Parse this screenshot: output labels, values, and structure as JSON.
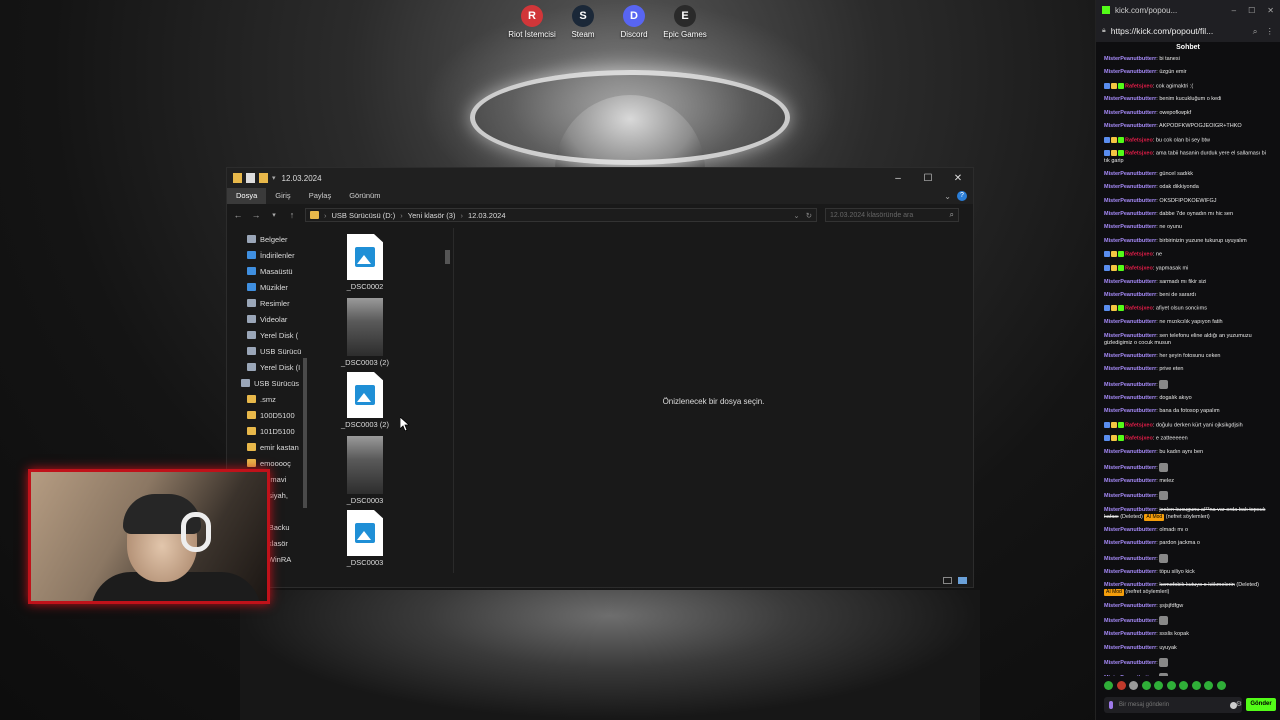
{
  "desktop": {
    "icons": [
      {
        "label": "Riot İstemcisi",
        "icon": "riot-icon",
        "color": "#d13639"
      },
      {
        "label": "Steam",
        "icon": "steam-icon",
        "color": "#1b2838"
      },
      {
        "label": "Discord",
        "icon": "discord-icon",
        "color": "#5865f2"
      },
      {
        "label": "Epic Games",
        "icon": "epic-games-icon",
        "color": "#2a2a2a"
      }
    ]
  },
  "explorer": {
    "title": "12.03.2024",
    "ribbon_tabs": [
      "Dosya",
      "Giriş",
      "Paylaş",
      "Görünüm"
    ],
    "breadcrumb": [
      "USB Sürücüsü (D:)",
      "Yeni klasör (3)",
      "12.03.2024"
    ],
    "search_placeholder": "12.03.2024 klasöründe ara",
    "nav_items": [
      {
        "label": "Belgeler",
        "icon": "documents-icon"
      },
      {
        "label": "İndirilenler",
        "icon": "downloads-icon"
      },
      {
        "label": "Masaüstü",
        "icon": "desktop-icon"
      },
      {
        "label": "Müzikler",
        "icon": "music-icon"
      },
      {
        "label": "Resimler",
        "icon": "pictures-icon"
      },
      {
        "label": "Videolar",
        "icon": "videos-icon"
      },
      {
        "label": "Yerel Disk (",
        "icon": "drive-icon"
      },
      {
        "label": "USB Sürücü",
        "icon": "usb-drive-icon"
      },
      {
        "label": "Yerel Disk (I",
        "icon": "drive-icon"
      },
      {
        "label": "USB Sürücüs",
        "icon": "usb-drive-icon"
      },
      {
        "label": ".smz",
        "icon": "folder-icon"
      },
      {
        "label": "100D5100",
        "icon": "folder-icon"
      },
      {
        "label": "101D5100",
        "icon": "folder-icon"
      },
      {
        "label": "emir kastan",
        "icon": "folder-icon"
      },
      {
        "label": "emooooç",
        "icon": "folder-icon"
      },
      {
        "label": "up mavi",
        "icon": "folder-icon"
      },
      {
        "label": "upsiyah,",
        "icon": "folder-icon"
      },
      {
        "label": "o",
        "icon": "folder-icon"
      },
      {
        "label": "IZ Backu",
        "icon": "folder-icon"
      },
      {
        "label": "ni klasör",
        "icon": "folder-icon"
      },
      {
        "label": "ni WinRA",
        "icon": "folder-icon"
      }
    ],
    "files": [
      {
        "name": "_DSC0002",
        "kind": "image-file"
      },
      {
        "name": "_DSC0003 (2)",
        "kind": "photo"
      },
      {
        "name": "_DSC0003 (2)",
        "kind": "image-file"
      },
      {
        "name": "_DSC0003",
        "kind": "photo"
      },
      {
        "name": "_DSC0003",
        "kind": "image-file"
      }
    ],
    "preview_message": "Önizlenecek bir dosya seçin."
  },
  "chat": {
    "tab_title": "kick.com/popou...",
    "url": "https://kick.com/popout/fil...",
    "header": "Sohbet",
    "messages": [
      {
        "user": "MisterPeanutbutterr",
        "text": "bi tanesi",
        "color": "#a78bfa",
        "badges": 0
      },
      {
        "user": "MisterPeanutbutterr",
        "text": "üzgün emir",
        "color": "#a78bfa",
        "badges": 0
      },
      {
        "user": "Rafetsjxeo",
        "text": "cok agimaktri :(",
        "color": "#e11d48",
        "badges": 3
      },
      {
        "user": "MisterPeanutbutterr",
        "text": "benim kucukluğum o kedi",
        "color": "#a78bfa",
        "badges": 0
      },
      {
        "user": "MisterPeanutbutterr",
        "text": "owepofkwpkf",
        "color": "#a78bfa",
        "badges": 0
      },
      {
        "user": "MisterPeanutbutterr",
        "text": "AKPODFKWPOGJEOIGR+THKO",
        "color": "#a78bfa",
        "badges": 0
      },
      {
        "user": "Rafetsjxeo",
        "text": "bu cok olan bi sey btw",
        "color": "#e11d48",
        "badges": 3
      },
      {
        "user": "Rafetsjxeo",
        "text": "ama tabii hasanin durduk yere el sallaması bi tık garip",
        "color": "#e11d48",
        "badges": 3
      },
      {
        "user": "MisterPeanutbutterr",
        "text": "güncel sadıkk",
        "color": "#a78bfa",
        "badges": 0
      },
      {
        "user": "MisterPeanutbutterr",
        "text": "odak dikkiyonda",
        "color": "#a78bfa",
        "badges": 0
      },
      {
        "user": "MisterPeanutbutterr",
        "text": "OKSDFIPOKOEWIFGJ",
        "color": "#a78bfa",
        "badges": 0
      },
      {
        "user": "MisterPeanutbutterr",
        "text": "dabbe 7de oynadın mı hic sen",
        "color": "#a78bfa",
        "badges": 0
      },
      {
        "user": "MisterPeanutbutterr",
        "text": "ne oyunu",
        "color": "#a78bfa",
        "badges": 0
      },
      {
        "user": "MisterPeanutbutterr",
        "text": "birbirinizin yuzune tukurup uyuyalım",
        "color": "#a78bfa",
        "badges": 0
      },
      {
        "user": "Rafetsjxeo",
        "text": "ne",
        "color": "#e11d48",
        "badges": 3
      },
      {
        "user": "Rafetsjxeo",
        "text": "yapmasak mi",
        "color": "#e11d48",
        "badges": 3
      },
      {
        "user": "MisterPeanutbutterr",
        "text": "sarmadı mı fikir sizi",
        "color": "#a78bfa",
        "badges": 0
      },
      {
        "user": "MisterPeanutbutterr",
        "text": "beni de sarardı",
        "color": "#a78bfa",
        "badges": 0
      },
      {
        "user": "Rafetsjxeo",
        "text": "afiyet olsun sonciıms",
        "color": "#e11d48",
        "badges": 3
      },
      {
        "user": "MisterPeanutbutterr",
        "text": "ne mızıkcılık yapıyon fatih",
        "color": "#a78bfa",
        "badges": 0
      },
      {
        "user": "MisterPeanutbutterr",
        "text": "sen telefonu eline aldığı an yuzumuzu gizledigimiz o cocuk musun",
        "color": "#a78bfa",
        "badges": 0
      },
      {
        "user": "MisterPeanutbutterr",
        "text": "her şeyin fotosunu ceken",
        "color": "#a78bfa",
        "badges": 0
      },
      {
        "user": "MisterPeanutbutterr",
        "text": "prive eten",
        "color": "#a78bfa",
        "badges": 0
      },
      {
        "user": "MisterPeanutbutterr",
        "text": "",
        "color": "#a78bfa",
        "badges": 0,
        "emote": true
      },
      {
        "user": "MisterPeanutbutterr",
        "text": "dogalık akıyo",
        "color": "#a78bfa",
        "badges": 0
      },
      {
        "user": "MisterPeanutbutterr",
        "text": "bana da fotosop yapalım",
        "color": "#a78bfa",
        "badges": 0
      },
      {
        "user": "Rafetsjxeo",
        "text": "doğulu derken kürt yani ojksikgdjsih",
        "color": "#e11d48",
        "badges": 3
      },
      {
        "user": "Rafetsjxeo",
        "text": "e zatteeeeen",
        "color": "#e11d48",
        "badges": 3
      },
      {
        "user": "MisterPeanutbutterr",
        "text": "bu kadın aynı ben",
        "color": "#a78bfa",
        "badges": 0
      },
      {
        "user": "MisterPeanutbutterr",
        "text": "",
        "color": "#a78bfa",
        "badges": 0,
        "emote": true
      },
      {
        "user": "MisterPeanutbutterr",
        "text": "melez",
        "color": "#a78bfa",
        "badges": 0
      },
      {
        "user": "MisterPeanutbutterr",
        "text": "",
        "color": "#a78bfa",
        "badges": 0,
        "emote": true
      },
      {
        "user": "MisterPeanutbutterr",
        "text": "jeolen kucugunu al**na var orda bak topcuk kafası",
        "color": "#a78bfa",
        "badges": 0,
        "deleted": "(Deleted)",
        "tag": "AI Mod",
        "note": "(nefret söylemleri)"
      },
      {
        "user": "MisterPeanutbutterr",
        "text": "olmadı mı o",
        "color": "#a78bfa",
        "badges": 0
      },
      {
        "user": "MisterPeanutbutterr",
        "text": "pardon jackma o",
        "color": "#a78bfa",
        "badges": 0
      },
      {
        "user": "MisterPeanutbutterr",
        "text": "",
        "color": "#a78bfa",
        "badges": 0,
        "emote": true
      },
      {
        "user": "MisterPeanutbutterr",
        "text": "töpu siliyo kick",
        "color": "#a78bfa",
        "badges": 0
      },
      {
        "user": "MisterPeanutbutterr",
        "text": "kemofobik kutuyo o kökmelerin",
        "color": "#a78bfa",
        "badges": 0,
        "deleted": "(Deleted)",
        "tag": "AI Mod",
        "note": "(nefret söylemleri)"
      },
      {
        "user": "MisterPeanutbutterr",
        "text": "şsjsjfdfgw",
        "color": "#a78bfa",
        "badges": 0
      },
      {
        "user": "MisterPeanutbutterr",
        "text": "",
        "color": "#a78bfa",
        "badges": 0,
        "emote": true
      },
      {
        "user": "MisterPeanutbutterr",
        "text": "ssslis kopak",
        "color": "#a78bfa",
        "badges": 0
      },
      {
        "user": "MisterPeanutbutterr",
        "text": "uyuyak",
        "color": "#a78bfa",
        "badges": 0
      },
      {
        "user": "MisterPeanutbutterr",
        "text": "",
        "color": "#a78bfa",
        "badges": 0,
        "emote": true
      },
      {
        "user": "MisterPeanutbutterr",
        "text": "",
        "color": "#a78bfa",
        "badges": 0,
        "emote": true
      }
    ],
    "input_placeholder": "Bir mesaj gönderin",
    "send_label": "Gönder",
    "accent": "#53fc18"
  }
}
